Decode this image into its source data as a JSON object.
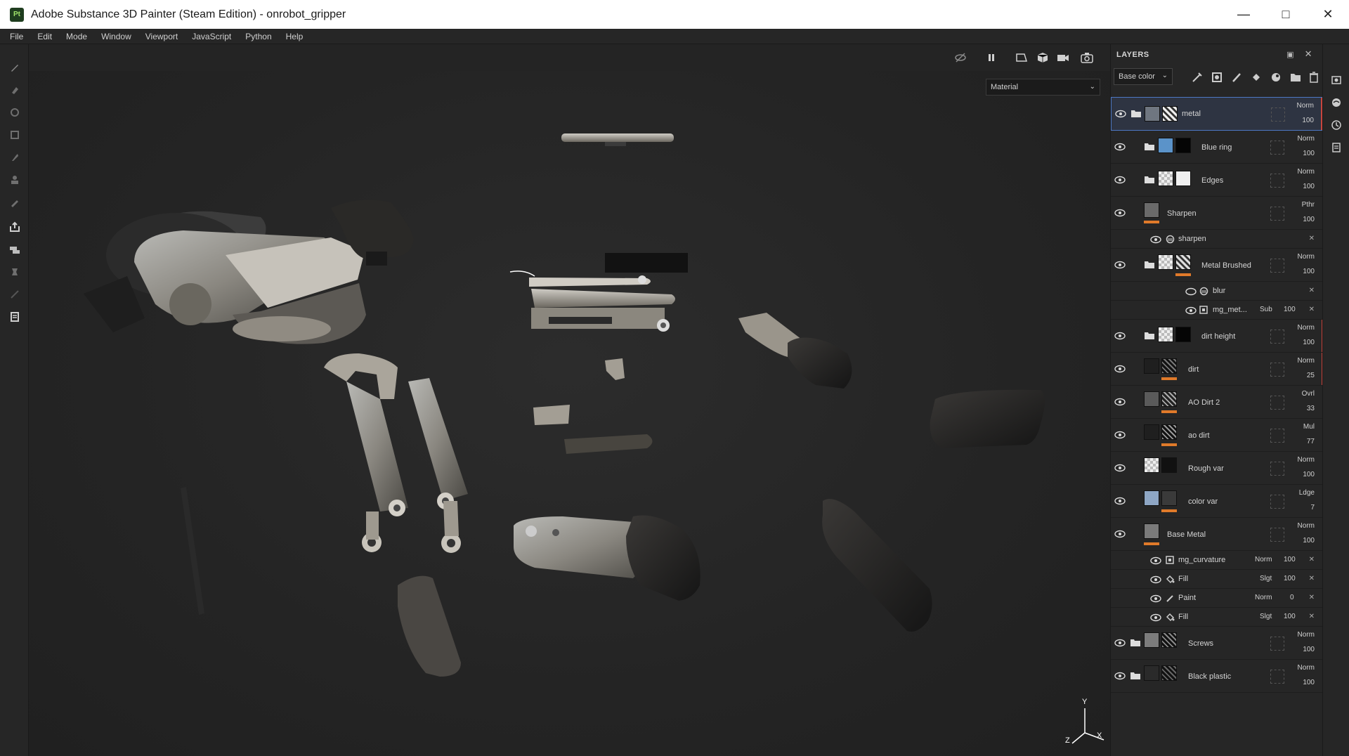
{
  "window": {
    "logo_text": "Pt",
    "title": "Adobe Substance 3D Painter (Steam Edition) - onrobot_gripper",
    "controls": [
      "minimize",
      "maximize",
      "close"
    ]
  },
  "menu": [
    "File",
    "Edit",
    "Mode",
    "Window",
    "Viewport",
    "JavaScript",
    "Python",
    "Help"
  ],
  "left_tools": [
    "paint-brush-icon",
    "eraser-icon",
    "projection-icon",
    "polygon-fill-icon",
    "smudge-icon",
    "clone-icon",
    "color-picker-icon",
    "bake-icon",
    "mesh-tool-icon",
    "measure-icon",
    "transform-icon",
    "document-icon"
  ],
  "viewport": {
    "display_mode": "Material",
    "toolbar_icons": [
      "hide-icon",
      "pause-icon",
      "view-mode-icon",
      "cube-icon",
      "camera-icon",
      "screenshot-icon"
    ],
    "axis_labels": {
      "x": "X",
      "y": "Y",
      "z": "Z"
    }
  },
  "layers_panel": {
    "title": "LAYERS",
    "channel": "Base color",
    "tool_icons": [
      "effects-icon",
      "mask-icon",
      "paint-layer-icon",
      "fill-layer-icon",
      "smart-material-icon",
      "folder-icon",
      "trash-icon"
    ],
    "layers": [
      {
        "name": "metal",
        "type": "folder",
        "blend": "Norm",
        "opacity": "100",
        "selected": true,
        "thumb_color": "#6f7680",
        "thumb2": "#9a9a9a",
        "red_bar": true
      },
      {
        "name": "Blue ring",
        "type": "folder-sub",
        "blend": "Norm",
        "opacity": "100",
        "thumb_color": "#5b93c9",
        "thumb2": "#050505"
      },
      {
        "name": "Edges",
        "type": "folder-sub",
        "blend": "Norm",
        "opacity": "100",
        "thumb_color": "checker",
        "thumb2": "#f0f0f0"
      },
      {
        "name": "Sharpen",
        "type": "fill",
        "blend": "Pthr",
        "opacity": "100",
        "thumb_color": "#6a6a6a",
        "orange": true
      },
      {
        "name": "sharpen",
        "type": "effect",
        "indent": 1
      },
      {
        "name": "Metal Brushed",
        "type": "folder-sub",
        "blend": "Norm",
        "opacity": "100",
        "thumb_color": "checker",
        "thumb2": "#8a8a8a",
        "orange": true
      },
      {
        "name": "blur",
        "type": "effect",
        "indent": 2
      },
      {
        "name": "mg_met...",
        "type": "effect-blend",
        "indent": 2,
        "blend": "Sub",
        "opacity": "100"
      },
      {
        "name": "dirt height",
        "type": "folder-sub",
        "blend": "Norm",
        "opacity": "100",
        "thumb_color": "checker",
        "thumb2": "#050505",
        "red_bar": true
      },
      {
        "name": "dirt",
        "type": "fill",
        "blend": "Norm",
        "opacity": "25",
        "thumb_color": "#1f1f1f",
        "thumb2": "#555555",
        "orange": true,
        "red_bar": true
      },
      {
        "name": "AO Dirt 2",
        "type": "fill",
        "blend": "Ovrl",
        "opacity": "33",
        "thumb_color": "#5a5a5a",
        "thumb2": "#777777",
        "orange": true
      },
      {
        "name": "ao dirt",
        "type": "fill",
        "blend": "Mul",
        "opacity": "77",
        "thumb_color": "#1f1f1f",
        "thumb2": "#666666",
        "orange": true
      },
      {
        "name": "Rough var",
        "type": "fill",
        "blend": "Norm",
        "opacity": "100",
        "thumb_color": "checker",
        "thumb2": "#111111"
      },
      {
        "name": "color var",
        "type": "fill",
        "blend": "Ldge",
        "opacity": "7",
        "thumb_color": "#8ea6c4",
        "thumb2": "#3a3a3a",
        "orange": true
      },
      {
        "name": "Base Metal",
        "type": "fill",
        "blend": "Norm",
        "opacity": "100",
        "thumb_color": "#7a7a7a",
        "orange": true
      },
      {
        "name": "mg_curvature",
        "type": "effect-blend",
        "indent": 1,
        "blend": "Norm",
        "opacity": "100"
      },
      {
        "name": "Fill",
        "type": "effect-blend",
        "indent": 1,
        "blend": "Slgt",
        "opacity": "100",
        "icon": "fill"
      },
      {
        "name": "Paint",
        "type": "effect-blend",
        "indent": 1,
        "blend": "Norm",
        "opacity": "0",
        "icon": "paint"
      },
      {
        "name": "Fill",
        "type": "effect-blend",
        "indent": 1,
        "blend": "Slgt",
        "opacity": "100",
        "icon": "fill"
      },
      {
        "name": "Screws",
        "type": "folder",
        "blend": "Norm",
        "opacity": "100",
        "thumb_color": "#7c7c7c",
        "thumb2": "#444444"
      },
      {
        "name": "Black plastic",
        "type": "folder",
        "blend": "Norm",
        "opacity": "100",
        "thumb_color": "#2a2a2a",
        "thumb2": "#3a3a3a"
      }
    ]
  },
  "right_strip_icons": [
    "texture-set-icon",
    "environment-icon",
    "history-icon",
    "properties-icon"
  ]
}
